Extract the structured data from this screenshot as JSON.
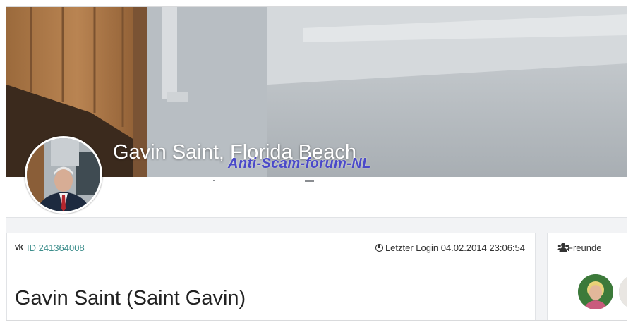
{
  "cover": {
    "title": "Gavin Saint, Florida Beach",
    "watermark": "Anti-Scam-forum-NL"
  },
  "profile": {
    "id_icon": "vk-icon",
    "id_link": "ID 241364008",
    "last_login_icon": "clock-icon",
    "last_login": "Letzter Login 04.02.2014 23:06:54",
    "full_name": "Gavin Saint (Saint Gavin)"
  },
  "friends": {
    "icon": "users-icon",
    "label": "Freunde",
    "avatars": [
      "friend-avatar-1",
      "friend-avatar-2"
    ]
  },
  "colors": {
    "link": "#3d8e8c",
    "watermark": "#4a49c9",
    "page_bg": "#f2f3f5"
  }
}
